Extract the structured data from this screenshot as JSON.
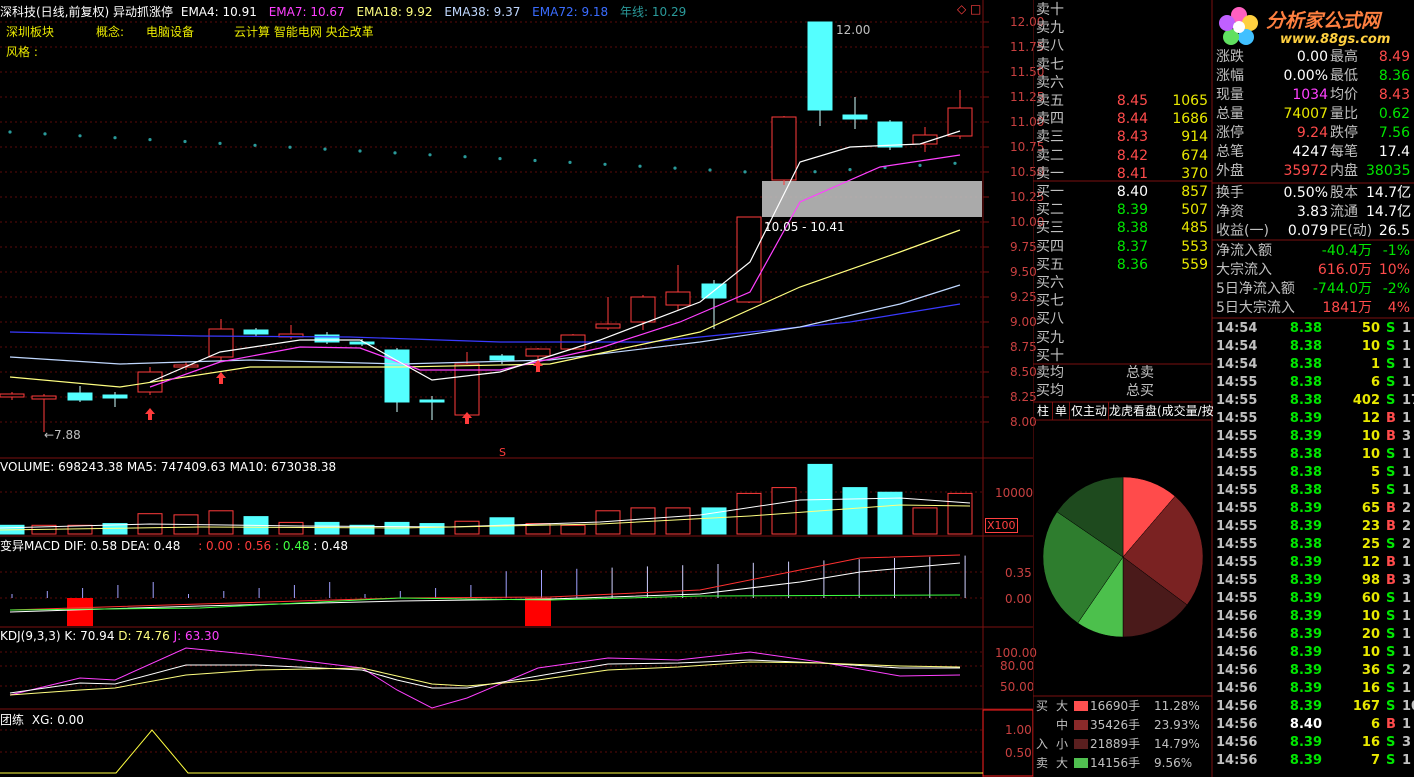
{
  "header": {
    "title": "深科技(日线,前复权)",
    "strategy": "异动抓涨停",
    "ema4": "EMA4: 10.91",
    "ema7": "EMA7: 10.67",
    "ema18": "EMA18: 9.92",
    "ema38": "EMA38: 9.37",
    "ema72": "EMA72: 9.18",
    "yearline": "年线: 10.29",
    "board_label": "深圳板块",
    "concept_label": "概念:",
    "concept1": "电脑设备",
    "concept2": "云计算 智能电网 央企改革",
    "style_label": "风格 :",
    "corner_icon": "diamond-icon"
  },
  "price_axis": [
    "12.00",
    "11.75",
    "11.50",
    "11.25",
    "11.00",
    "10.75",
    "10.50",
    "10.25",
    "10.00",
    "9.75",
    "9.50",
    "9.25",
    "9.00",
    "8.75",
    "8.50",
    "8.25",
    "8.00"
  ],
  "annotations": {
    "high": "12.00",
    "low": "←7.88",
    "range": "10.05 - 10.41",
    "s_mark": "S"
  },
  "volume_panel": {
    "header": "VOLUME: 698243.38  MA5: 747409.63  MA10: 673038.38",
    "axis_label": "10000",
    "unit_label": "X100"
  },
  "macd_panel": {
    "name": "变异MACD",
    "dif": "DIF: 0.58",
    "dea": "DEA: 0.48",
    "v1": ": 0.00",
    "v2": ": 0.56",
    "v3": ": 0.48",
    "v4": ": 0.48",
    "axis": [
      "0.35",
      "0.00"
    ]
  },
  "kdj_panel": {
    "name": "KDJ(9,3,3)",
    "k": "K: 70.94",
    "d": "D: 74.76",
    "j": "J: 63.30",
    "axis": [
      "100.00",
      "80.00",
      "50.00"
    ]
  },
  "xg_panel": {
    "name": "团练",
    "xg": "XG: 0.00",
    "axis": [
      "1.00",
      "0.50"
    ]
  },
  "logo": {
    "title": "分析家公式网",
    "url": "www.88gs.com"
  },
  "order_book": {
    "sell": [
      {
        "label": "卖十",
        "price": "",
        "vol": ""
      },
      {
        "label": "卖九",
        "price": "",
        "vol": ""
      },
      {
        "label": "卖八",
        "price": "",
        "vol": ""
      },
      {
        "label": "卖七",
        "price": "",
        "vol": ""
      },
      {
        "label": "卖六",
        "price": "",
        "vol": ""
      },
      {
        "label": "卖五",
        "price": "8.45",
        "vol": "1065"
      },
      {
        "label": "卖四",
        "price": "8.44",
        "vol": "1686"
      },
      {
        "label": "卖三",
        "price": "8.43",
        "vol": "914"
      },
      {
        "label": "卖二",
        "price": "8.42",
        "vol": "674"
      },
      {
        "label": "卖一",
        "price": "8.41",
        "vol": "370"
      }
    ],
    "buy": [
      {
        "label": "买一",
        "price": "8.40",
        "vol": "857"
      },
      {
        "label": "买二",
        "price": "8.39",
        "vol": "507"
      },
      {
        "label": "买三",
        "price": "8.38",
        "vol": "485"
      },
      {
        "label": "买四",
        "price": "8.37",
        "vol": "553"
      },
      {
        "label": "买五",
        "price": "8.36",
        "vol": "559"
      },
      {
        "label": "买六",
        "price": "",
        "vol": ""
      },
      {
        "label": "买七",
        "price": "",
        "vol": ""
      },
      {
        "label": "买八",
        "price": "",
        "vol": ""
      },
      {
        "label": "买九",
        "price": "",
        "vol": ""
      },
      {
        "label": "买十",
        "price": "",
        "vol": ""
      }
    ],
    "avg_sell": "卖均",
    "avg_buy": "买均",
    "total_sell": "总卖",
    "total_buy": "总买"
  },
  "tabs": [
    "柱",
    "单",
    "仅主动",
    "龙虎看盘(成交量/按"
  ],
  "stats": [
    {
      "l1": "涨跌",
      "v1": "0.00",
      "c1": "white",
      "l2": "最高",
      "v2": "8.49",
      "c2": "red"
    },
    {
      "l1": "涨幅",
      "v1": "0.00%",
      "c1": "white",
      "l2": "最低",
      "v2": "8.36",
      "c2": "green"
    },
    {
      "l1": "现量",
      "v1": "1034",
      "c1": "magenta",
      "l2": "均价",
      "v2": "8.43",
      "c2": "red"
    },
    {
      "l1": "总量",
      "v1": "74007",
      "c1": "yellow",
      "l2": "量比",
      "v2": "0.62",
      "c2": "green"
    },
    {
      "l1": "涨停",
      "v1": "9.24",
      "c1": "red",
      "l2": "跌停",
      "v2": "7.56",
      "c2": "green"
    },
    {
      "l1": "总笔",
      "v1": "4247",
      "c1": "white",
      "l2": "每笔",
      "v2": "17.4",
      "c2": "white"
    },
    {
      "l1": "外盘",
      "v1": "35972",
      "c1": "red",
      "l2": "内盘",
      "v2": "38035",
      "c2": "green"
    }
  ],
  "stats2": [
    {
      "l1": "换手",
      "v1": "0.50%",
      "l2": "股本",
      "v2": "14.7亿"
    },
    {
      "l1": "净资",
      "v1": "3.83",
      "l2": "流通",
      "v2": "14.7亿"
    },
    {
      "l1": "收益(一)",
      "v1": "0.079",
      "l2": "PE(动)",
      "v2": "26.5"
    }
  ],
  "flows": [
    {
      "label": "净流入额",
      "value": "-40.4万",
      "pct": "-1%",
      "color": "green"
    },
    {
      "label": "大宗流入",
      "value": "616.0万",
      "pct": "10%",
      "color": "red"
    },
    {
      "label": "5日净流入额",
      "value": "-744.0万",
      "pct": "-2%",
      "color": "green"
    },
    {
      "label": "5日大宗流入",
      "value": "1841万",
      "pct": "4%",
      "color": "red"
    }
  ],
  "pie": {
    "slices": [
      {
        "name": "买大",
        "value": 11.28,
        "color": "#ff4b4b"
      },
      {
        "name": "买中",
        "value": 23.93,
        "color": "#7a2222"
      },
      {
        "name": "买小",
        "value": 14.79,
        "color": "#4a1a1a"
      },
      {
        "name": "卖大",
        "value": 9.56,
        "color": "#4cc04c"
      },
      {
        "name": "卖中",
        "value": 25.0,
        "color": "#2e7d2e"
      },
      {
        "name": "卖小",
        "value": 15.44,
        "color": "#1e4a1e"
      }
    ]
  },
  "flow_breakdown": [
    {
      "side": "买",
      "size": "大",
      "vol": "16690手",
      "pct": "11.28%",
      "color": "#ff5050"
    },
    {
      "side": "",
      "size": "中",
      "vol": "35426手",
      "pct": "23.93%",
      "color": "#8a2a2a"
    },
    {
      "side": "入",
      "size": "小",
      "vol": "21889手",
      "pct": "14.79%",
      "color": "#5a1f1f"
    },
    {
      "side": "卖",
      "size": "大",
      "vol": "14156手",
      "pct": "9.56%",
      "color": "#50c050"
    }
  ],
  "ticks": [
    {
      "t": "14:54",
      "p": "8.38",
      "v": "50",
      "s": "S",
      "x": "1",
      "pc": "green"
    },
    {
      "t": "14:54",
      "p": "8.38",
      "v": "10",
      "s": "S",
      "x": "1",
      "pc": "green"
    },
    {
      "t": "14:54",
      "p": "8.38",
      "v": "1",
      "s": "S",
      "x": "1",
      "pc": "green"
    },
    {
      "t": "14:55",
      "p": "8.38",
      "v": "6",
      "s": "S",
      "x": "1",
      "pc": "green"
    },
    {
      "t": "14:55",
      "p": "8.38",
      "v": "402",
      "s": "S",
      "x": "17",
      "pc": "green"
    },
    {
      "t": "14:55",
      "p": "8.39",
      "v": "12",
      "s": "B",
      "x": "1",
      "pc": "green"
    },
    {
      "t": "14:55",
      "p": "8.39",
      "v": "10",
      "s": "B",
      "x": "3",
      "pc": "green"
    },
    {
      "t": "14:55",
      "p": "8.38",
      "v": "10",
      "s": "S",
      "x": "1",
      "pc": "green"
    },
    {
      "t": "14:55",
      "p": "8.38",
      "v": "5",
      "s": "S",
      "x": "1",
      "pc": "green"
    },
    {
      "t": "14:55",
      "p": "8.38",
      "v": "5",
      "s": "S",
      "x": "1",
      "pc": "green"
    },
    {
      "t": "14:55",
      "p": "8.39",
      "v": "65",
      "s": "B",
      "x": "2",
      "pc": "green"
    },
    {
      "t": "14:55",
      "p": "8.39",
      "v": "23",
      "s": "B",
      "x": "2",
      "pc": "green"
    },
    {
      "t": "14:55",
      "p": "8.38",
      "v": "25",
      "s": "S",
      "x": "2",
      "pc": "green"
    },
    {
      "t": "14:55",
      "p": "8.39",
      "v": "12",
      "s": "B",
      "x": "1",
      "pc": "green"
    },
    {
      "t": "14:55",
      "p": "8.39",
      "v": "98",
      "s": "B",
      "x": "3",
      "pc": "green"
    },
    {
      "t": "14:55",
      "p": "8.39",
      "v": "60",
      "s": "S",
      "x": "1",
      "pc": "green"
    },
    {
      "t": "14:56",
      "p": "8.39",
      "v": "10",
      "s": "S",
      "x": "1",
      "pc": "green"
    },
    {
      "t": "14:56",
      "p": "8.39",
      "v": "20",
      "s": "S",
      "x": "1",
      "pc": "green"
    },
    {
      "t": "14:56",
      "p": "8.39",
      "v": "10",
      "s": "S",
      "x": "1",
      "pc": "green"
    },
    {
      "t": "14:56",
      "p": "8.39",
      "v": "36",
      "s": "S",
      "x": "2",
      "pc": "green"
    },
    {
      "t": "14:56",
      "p": "8.39",
      "v": "16",
      "s": "S",
      "x": "1",
      "pc": "green"
    },
    {
      "t": "14:56",
      "p": "8.39",
      "v": "167",
      "s": "S",
      "x": "10",
      "pc": "green"
    },
    {
      "t": "14:56",
      "p": "8.40",
      "v": "6",
      "s": "B",
      "x": "1",
      "pc": "white"
    },
    {
      "t": "14:56",
      "p": "8.39",
      "v": "16",
      "s": "S",
      "x": "3",
      "pc": "green"
    },
    {
      "t": "14:56",
      "p": "8.39",
      "v": "7",
      "s": "S",
      "x": "1",
      "pc": "green"
    }
  ],
  "colors": {
    "up": "#ff3b3b",
    "down": "#54ffff",
    "grid": "#7a1010",
    "ema4": "#ffffff",
    "ema7": "#ff40ff",
    "ema18": "#ffff80",
    "ema38": "#c0d8ff",
    "ema72": "#3a3aff",
    "yearline": "#2a9a9a"
  }
}
